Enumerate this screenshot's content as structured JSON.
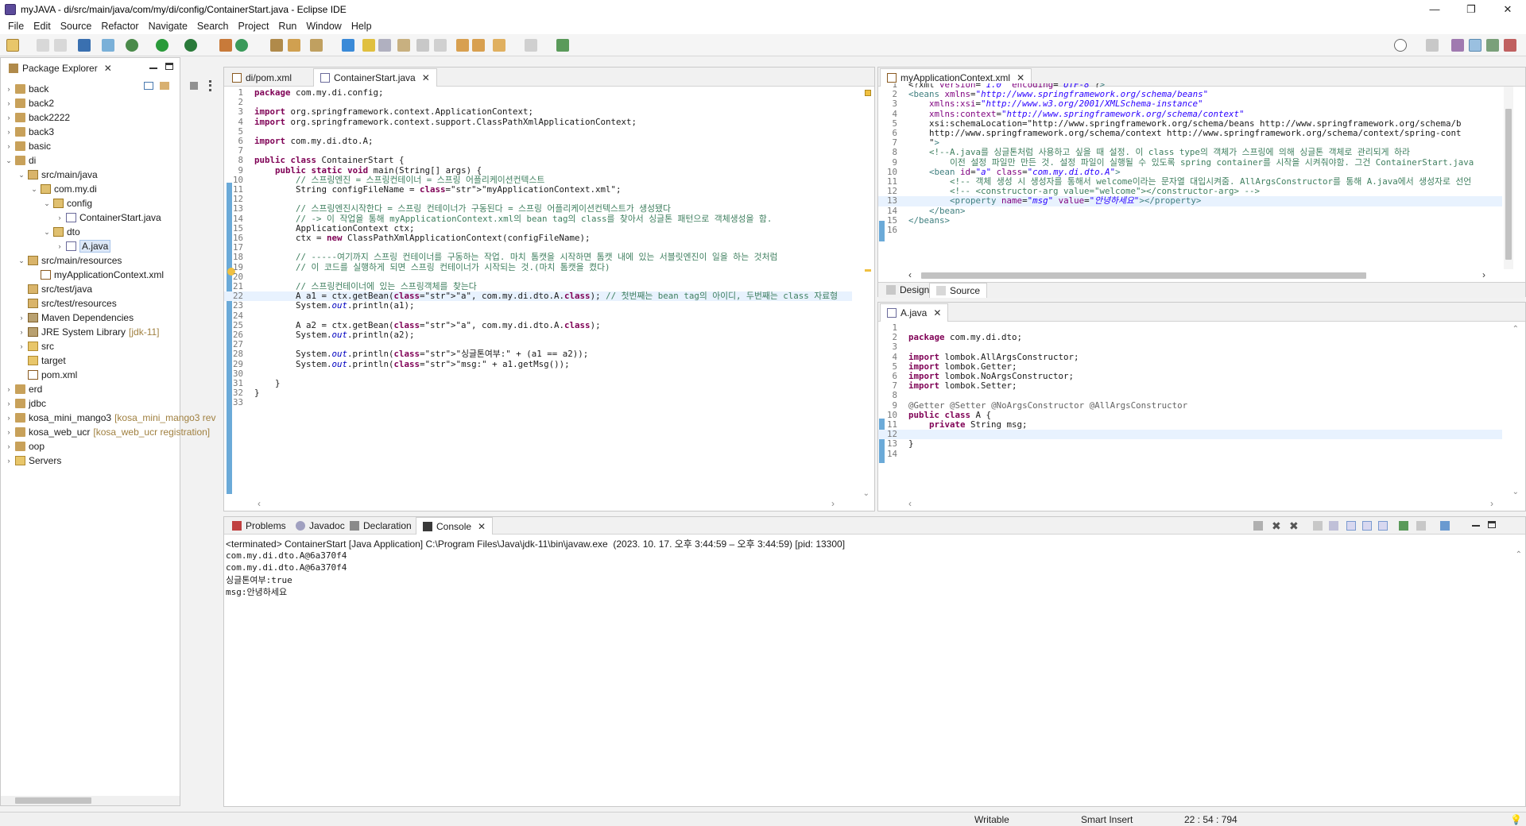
{
  "window": {
    "title": "myJAVA - di/src/main/java/com/my/di/config/ContainerStart.java - Eclipse IDE",
    "controls": [
      "—",
      "❐",
      "✕"
    ]
  },
  "menu": [
    "File",
    "Edit",
    "Source",
    "Refactor",
    "Navigate",
    "Search",
    "Project",
    "Run",
    "Window",
    "Help"
  ],
  "package_explorer": {
    "tab_label": "Package Explorer",
    "tree": [
      {
        "label": "back",
        "extra": ""
      },
      {
        "label": "back2",
        "extra": ""
      },
      {
        "label": "back2222",
        "extra": ""
      },
      {
        "label": "back3",
        "extra": ""
      },
      {
        "label": "basic",
        "extra": ""
      },
      {
        "label": "di",
        "extra": ""
      },
      {
        "label": "src/main/java",
        "extra": ""
      },
      {
        "label": "com.my.di",
        "extra": ""
      },
      {
        "label": "config",
        "extra": ""
      },
      {
        "label": "ContainerStart.java",
        "extra": ""
      },
      {
        "label": "dto",
        "extra": ""
      },
      {
        "label": "A.java",
        "extra": ""
      },
      {
        "label": "src/main/resources",
        "extra": ""
      },
      {
        "label": "myApplicationContext.xml",
        "extra": ""
      },
      {
        "label": "src/test/java",
        "extra": ""
      },
      {
        "label": "src/test/resources",
        "extra": ""
      },
      {
        "label": "Maven Dependencies",
        "extra": ""
      },
      {
        "label": "JRE System Library",
        "extra": "[jdk-11]"
      },
      {
        "label": "src",
        "extra": ""
      },
      {
        "label": "target",
        "extra": ""
      },
      {
        "label": "pom.xml",
        "extra": ""
      },
      {
        "label": "erd",
        "extra": ""
      },
      {
        "label": "jdbc",
        "extra": ""
      },
      {
        "label": "kosa_mini_mango3",
        "extra": "[kosa_mini_mango3 rev"
      },
      {
        "label": "kosa_web_ucr",
        "extra": "[kosa_web_ucr registration]"
      },
      {
        "label": "oop",
        "extra": ""
      },
      {
        "label": "Servers",
        "extra": ""
      }
    ]
  },
  "editor_main": {
    "tabs": [
      "di/pom.xml",
      "ContainerStart.java"
    ],
    "line_numbers": [
      "1",
      "2",
      "3",
      "4",
      "5",
      "6",
      "7",
      "8",
      "9",
      "10",
      "11",
      "12",
      "13",
      "14",
      "15",
      "16",
      "17",
      "18",
      "19",
      "20",
      "21",
      "22",
      "23",
      "24",
      "25",
      "26",
      "27",
      "28",
      "29",
      "30",
      "31",
      "32",
      "33"
    ],
    "lines": [
      "package com.my.di.config;",
      "",
      "import org.springframework.context.ApplicationContext;",
      "import org.springframework.context.support.ClassPathXmlApplicationContext;",
      "",
      "import com.my.di.dto.A;",
      "",
      "public class ContainerStart {",
      "    public static void main(String[] args) {",
      "        // 스프링엔진 = 스프링컨테이너 = 스프링 어플리케이션컨텍스트",
      "        String configFileName = \"myApplicationContext.xml\";",
      "",
      "        // 스프링엔진시작한다 = 스프링 컨테이너가 구동된다 = 스프링 어플리케이션컨텍스트가 생성됐다",
      "        // -> 이 작업을 통해 myApplicationContext.xml의 bean tag의 class를 찾아서 싱글톤 패턴으로 객체생성을 함.",
      "        ApplicationContext ctx;",
      "        ctx = new ClassPathXmlApplicationContext(configFileName);",
      "",
      "        // -----여기까지 스프링 컨테이너를 구동하는 작업. 마치 톰캣을 시작하면 톰캣 내에 있는 서블릿엔진이 일을 하는 것처럼",
      "        // 이 코드를 실행하게 되면 스프링 컨테이너가 시작되는 것.(마치 톰캣을 켰다)",
      "",
      "        // 스프링컨테이너에 있는 스프링객체를 찾는다",
      "        A a1 = ctx.getBean(\"a\", com.my.di.dto.A.class); // 첫번째는 bean tag의 아이디, 두번째는 class 자료형",
      "        System.out.println(a1);",
      "",
      "        A a2 = ctx.getBean(\"a\", com.my.di.dto.A.class);",
      "        System.out.println(a2);",
      "",
      "        System.out.println(\"싱글톤여부:\" + (a1 == a2));",
      "        System.out.println(\"msg:\" + a1.getMsg());",
      "",
      "    }",
      "}",
      ""
    ]
  },
  "editor_xml": {
    "tab": "myApplicationContext.xml",
    "line_numbers": [
      "1",
      "2",
      "3",
      "4",
      "5",
      "6",
      "7",
      "8",
      "9",
      "10",
      "11",
      "12",
      "13",
      "14",
      "15",
      "16"
    ],
    "lines": [
      "<?xml version=\"1.0\" encoding=\"UTF-8\"?>",
      "<beans xmlns=\"http://www.springframework.org/schema/beans\"",
      "    xmlns:xsi=\"http://www.w3.org/2001/XMLSchema-instance\"",
      "    xmlns:context=\"http://www.springframework.org/schema/context\"",
      "    xsi:schemaLocation=\"http://www.springframework.org/schema/beans http://www.springframework.org/schema/b",
      "    http://www.springframework.org/schema/context http://www.springframework.org/schema/context/spring-cont",
      "    \">",
      "    <!--A.java를 싱글톤처럼 사용하고 싶을 때 설정. 이 class type의 객체가 스프링에 의해 싱글톤 객체로 관리되게 하라",
      "        이전 설정 파일만 만든 것. 설정 파일이 실행될 수 있도록 spring container를 시작을 시켜줘야함. 그건 ContainerStart.java",
      "    <bean id=\"a\" class=\"com.my.di.dto.A\">",
      "        <!-- 객체 생성 시 생성자를 통해서 welcome이라는 문자열 대입시켜줌. AllArgsConstructor를 통해 A.java에서 생성자로 선언",
      "        <!-- <constructor-arg value=\"welcome\"></constructor-arg> -->",
      "        <property name=\"msg\" value=\"안녕하세요\"></property>",
      "    </bean>",
      "</beans>",
      ""
    ],
    "bottom_tabs": [
      "Design",
      "Source"
    ]
  },
  "editor_a": {
    "tab": "A.java",
    "line_numbers": [
      "1",
      "2",
      "3",
      "4",
      "5",
      "6",
      "7",
      "8",
      "9",
      "10",
      "11",
      "12",
      "13",
      "14"
    ],
    "lines": [
      "",
      "package com.my.di.dto;",
      "",
      "import lombok.AllArgsConstructor;",
      "import lombok.Getter;",
      "import lombok.NoArgsConstructor;",
      "import lombok.Setter;",
      "",
      "@Getter @Setter @NoArgsConstructor @AllArgsConstructor",
      "public class A {",
      "    private String msg;",
      "",
      "}",
      ""
    ]
  },
  "console": {
    "tabs": [
      "Problems",
      "Javadoc",
      "Declaration",
      "Console"
    ],
    "header": "<terminated> ContainerStart [Java Application] C:\\Program Files\\Java\\jdk-11\\bin\\javaw.exe  (2023. 10. 17. 오후 3:44:59 – 오후 3:44:59) [pid: 13300]",
    "output": [
      "com.my.di.dto.A@6a370f4",
      "com.my.di.dto.A@6a370f4",
      "싱글톤여부:true",
      "msg:안녕하세요"
    ]
  },
  "status": {
    "mode": "Writable",
    "insert": "Smart Insert",
    "position": "22 : 54 : 794"
  }
}
